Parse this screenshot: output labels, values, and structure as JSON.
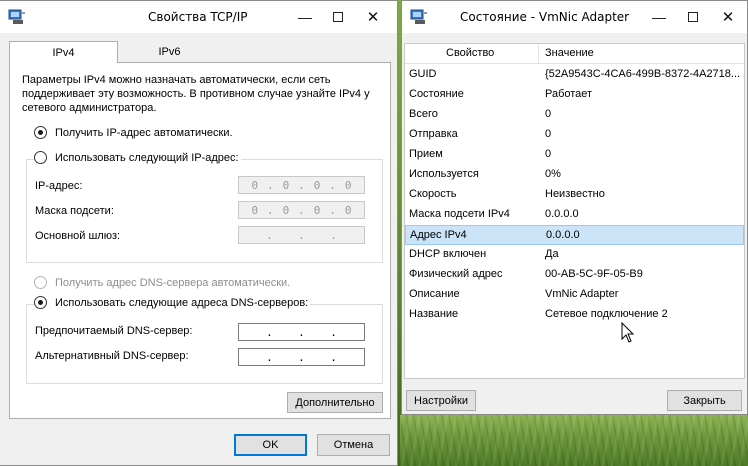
{
  "left_window": {
    "title": "Свойства TCP/IP",
    "tabs": [
      {
        "label": "IPv4"
      },
      {
        "label": "IPv6"
      }
    ],
    "description": "Параметры IPv4 можно назначать автоматически, если сеть поддерживает эту возможность. В противном случае узнайте IPv4 у сетевого администратора.",
    "radio_ip_auto": "Получить IP-адрес автоматически.",
    "radio_ip_manual": "Использовать следующий IP-адрес:",
    "ip_label": "IP-адрес:",
    "mask_label": "Маска подсети:",
    "gateway_label": "Основной шлюз:",
    "ip_value": [
      "0",
      "0",
      "0",
      "0"
    ],
    "mask_value": [
      "0",
      "0",
      "0",
      "0"
    ],
    "gateway_value": [
      "",
      "",
      "",
      ""
    ],
    "radio_dns_auto": "Получить адрес DNS-сервера автоматически.",
    "radio_dns_manual": "Использовать следующие адреса DNS-серверов:",
    "dns_pref_label": "Предпочитаемый DNS-сервер:",
    "dns_alt_label": "Альтернативный DNS-сервер:",
    "dns_pref_value": [
      "",
      "",
      "",
      ""
    ],
    "dns_alt_value": [
      "",
      "",
      "",
      ""
    ],
    "advanced_button": "Дополнительно",
    "ok_button": "OK",
    "cancel_button": "Отмена"
  },
  "right_window": {
    "title": "Состояние - VmNic Adapter",
    "col_property": "Свойство",
    "col_value": "Значение",
    "rows": [
      {
        "property": "GUID",
        "value": "{52A9543C-4CA6-499B-8372-4A2718..."
      },
      {
        "property": "Состояние",
        "value": "Работает"
      },
      {
        "property": "Всего",
        "value": "0"
      },
      {
        "property": "Отправка",
        "value": "0"
      },
      {
        "property": "Прием",
        "value": "0"
      },
      {
        "property": "Используется",
        "value": "0%"
      },
      {
        "property": "Скорость",
        "value": "Неизвестно"
      },
      {
        "property": "Маска подсети IPv4",
        "value": "0.0.0.0"
      },
      {
        "property": "Адрес IPv4",
        "value": "0.0.0.0"
      },
      {
        "property": "DHCP включен",
        "value": "Да"
      },
      {
        "property": "Физический адрес",
        "value": "00-AB-5C-9F-05-B9"
      },
      {
        "property": "Описание",
        "value": "VmNic Adapter"
      },
      {
        "property": "Название",
        "value": "Сетевое подключение 2"
      }
    ],
    "selected_row": 8,
    "settings_button": "Настройки",
    "close_button": "Закрыть"
  },
  "icons": {
    "app": "network-adapter-icon",
    "minimize": "minimize-icon",
    "maximize": "maximize-icon",
    "close": "close-icon",
    "cursor": "mouse-pointer-icon"
  },
  "colors": {
    "selection": "#cce4f7",
    "default_button_border": "#0078d7",
    "window_bg": "#f0f0f0"
  }
}
